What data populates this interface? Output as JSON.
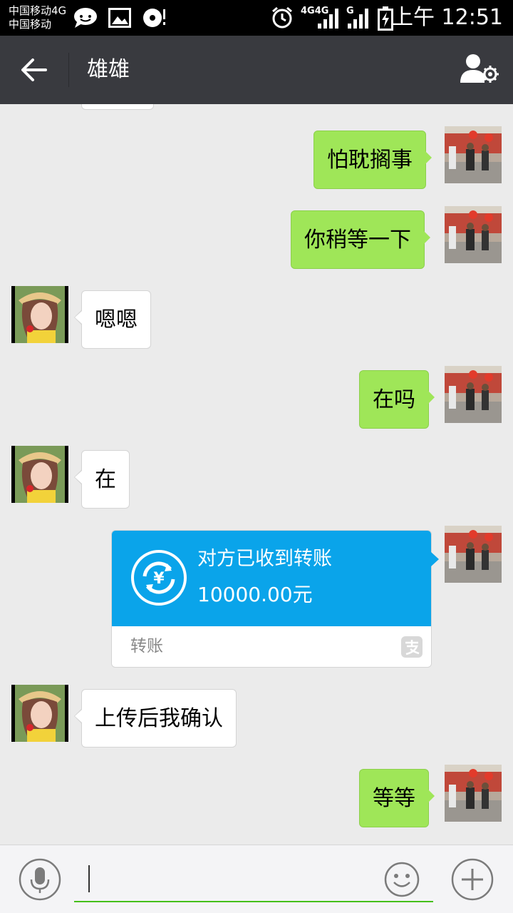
{
  "status_bar": {
    "carrier_line1": "中国移动4G",
    "carrier_line2": "中国移动",
    "network": "4G4G",
    "network2": "G",
    "time": "上午 12:51"
  },
  "header": {
    "title": "雄雄",
    "back_icon": "arrow-left-icon",
    "profile_icon": "person-settings-icon"
  },
  "messages": [
    {
      "side": "out",
      "text": "怕耽搁事"
    },
    {
      "side": "out",
      "text": "你稍等一下"
    },
    {
      "side": "in",
      "text": "嗯嗯"
    },
    {
      "side": "out",
      "text": "在吗"
    },
    {
      "side": "in",
      "text": "在"
    },
    {
      "side": "in",
      "text": "上传后我确认"
    },
    {
      "side": "out",
      "text": "等等"
    }
  ],
  "transfer": {
    "title": "对方已收到转账",
    "amount": "10000.00元",
    "label": "转账"
  },
  "input_bar": {
    "voice_icon": "microphone-icon",
    "emoji_icon": "smiley-icon",
    "plus_icon": "plus-icon"
  },
  "colors": {
    "header_bg": "#393a3f",
    "outgoing_bubble": "#9fe658",
    "incoming_bubble": "#ffffff",
    "transfer_blue": "#0aa4ea",
    "chat_bg": "#ebebeb"
  }
}
